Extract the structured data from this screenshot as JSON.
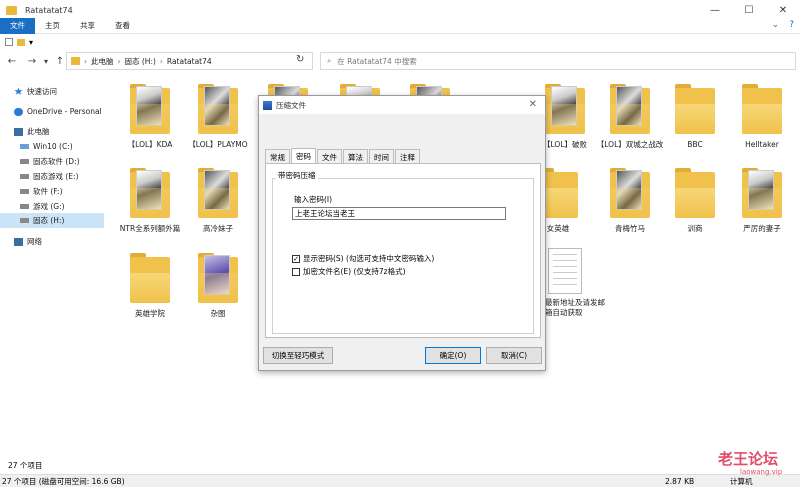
{
  "window": {
    "title": "Ratatatat74",
    "controls": [
      "—",
      "☐",
      "✕"
    ]
  },
  "ribbon": {
    "tabs": [
      "文件",
      "主页",
      "共享",
      "查看"
    ],
    "active_tab": "文件",
    "right_icons": [
      "chevron-down-icon",
      "help-icon"
    ]
  },
  "quick_access": {
    "dropdown": "▾"
  },
  "nav": {
    "back": "←",
    "forward": "→",
    "recent": "▾",
    "up": "↑",
    "breadcrumb": [
      "此电脑",
      "固态 (H:)",
      "Ratatatat74"
    ],
    "refresh": "↻",
    "search_placeholder": "在 Ratatatat74 中搜索"
  },
  "sidebar": {
    "items": [
      {
        "label": "快速访问",
        "icon": "star-icon",
        "color": "#2c7ad6"
      },
      {
        "label": "OneDrive - Personal",
        "icon": "cloud-icon",
        "color": "#2c7ad6"
      },
      {
        "label": "此电脑",
        "icon": "computer-icon",
        "color": "#3b6ea5"
      },
      {
        "label": "Win10 (C:)",
        "icon": "drive-icon",
        "color": "#6b9ed6"
      },
      {
        "label": "固态软件 (D:)",
        "icon": "drive-icon",
        "color": "#888"
      },
      {
        "label": "固态游戏 (E:)",
        "icon": "drive-icon",
        "color": "#888"
      },
      {
        "label": "软件 (F:)",
        "icon": "drive-icon",
        "color": "#888"
      },
      {
        "label": "游戏 (G:)",
        "icon": "drive-icon",
        "color": "#888"
      },
      {
        "label": "固态 (H:)",
        "icon": "drive-icon",
        "color": "#888",
        "selected": true
      },
      {
        "label": "网络",
        "icon": "network-icon",
        "color": "#3b6ea5"
      }
    ]
  },
  "files": [
    {
      "label": "【LOL】KDA",
      "type": "folder",
      "thumb": "anime"
    },
    {
      "label": "【LOL】PLAYMO",
      "type": "folder",
      "thumb": "dark"
    },
    {
      "label": "",
      "type": "folder",
      "thumb": "dark"
    },
    {
      "label": "",
      "type": "folder",
      "thumb": "anime"
    },
    {
      "label": "",
      "type": "folder",
      "thumb": "dark"
    },
    {
      "label": "【LOL】破败",
      "type": "folder",
      "thumb": "anime"
    },
    {
      "label": "【LOL】双城之战改",
      "type": "folder",
      "thumb": "dark"
    },
    {
      "label": "BBC",
      "type": "folder",
      "thumb": "none"
    },
    {
      "label": "Helltaker",
      "type": "folder",
      "thumb": "none"
    },
    {
      "label": "NTR全系列额外篇",
      "type": "folder",
      "thumb": "anime"
    },
    {
      "label": "高冷妹子",
      "type": "folder",
      "thumb": "dark"
    },
    {
      "label": "女英雄",
      "type": "folder",
      "thumb": "none"
    },
    {
      "label": "青梅竹马",
      "type": "folder",
      "thumb": "dark"
    },
    {
      "label": "训商",
      "type": "folder",
      "thumb": "none"
    },
    {
      "label": "严厉的妻子",
      "type": "folder",
      "thumb": "anime"
    },
    {
      "label": "英雄学院",
      "type": "folder",
      "thumb": "none"
    },
    {
      "label": "杂图",
      "type": "folder",
      "thumb": "blue"
    },
    {
      "label": "最新地址及请发邮箱自动获取",
      "type": "document",
      "thumb": "none"
    }
  ],
  "status": {
    "count": "27 个项目",
    "bottom": "27 个项目 (磁盘可用空间: 16.6 GB)",
    "size": "2.87 KB",
    "location": "计算机"
  },
  "watermark": {
    "text": "老王论坛",
    "sub": "laowang.vip"
  },
  "dialog": {
    "title": "压缩文件",
    "close": "✕",
    "tabs": [
      "常规",
      "密码",
      "文件",
      "算法",
      "时间",
      "注释"
    ],
    "active_tab": "密码",
    "group_title": "带密码压缩",
    "password_label": "输入密码(I)",
    "password_value": "上老王论坛当老王",
    "show_password": {
      "label": "显示密码(S) (勾选可支持中文密码输入)",
      "checked": true
    },
    "encrypt_names": {
      "label": "加密文件名(E) (仅支持7z格式)",
      "checked": false
    },
    "btn_mode": "切换至轻巧模式",
    "btn_ok": "确定(O)",
    "btn_cancel": "取消(C)"
  }
}
